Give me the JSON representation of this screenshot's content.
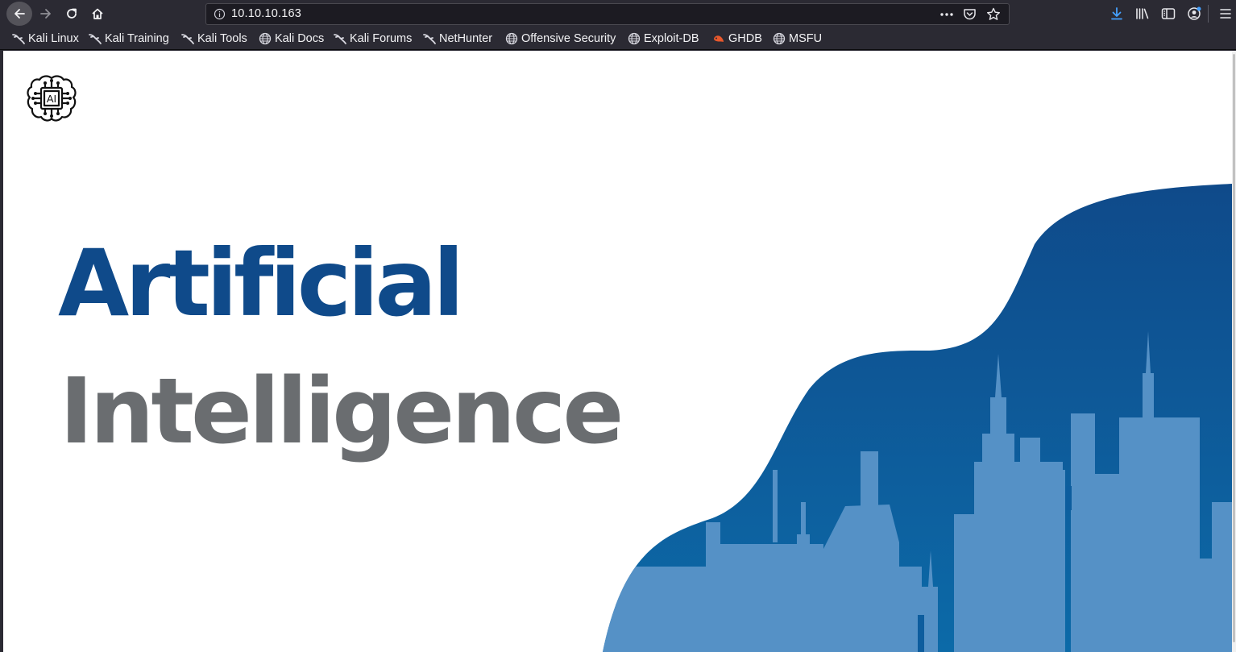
{
  "browser": {
    "url": "10.10.10.163",
    "bookmarks": [
      {
        "label": "Kali Linux",
        "icon": "kali-dragon-icon"
      },
      {
        "label": "Kali Training",
        "icon": "kali-dragon-icon"
      },
      {
        "label": "Kali Tools",
        "icon": "kali-dragon-icon"
      },
      {
        "label": "Kali Docs",
        "icon": "globe-icon"
      },
      {
        "label": "Kali Forums",
        "icon": "kali-dragon-icon"
      },
      {
        "label": "NetHunter",
        "icon": "kali-dragon-icon"
      },
      {
        "label": "Offensive Security",
        "icon": "globe-icon"
      },
      {
        "label": "Exploit-DB",
        "icon": "globe-icon"
      },
      {
        "label": "GHDB",
        "icon": "ghdb-icon"
      },
      {
        "label": "MSFU",
        "icon": "globe-icon"
      }
    ]
  },
  "page": {
    "logo_text": "AI",
    "headline_1": "Artificial",
    "headline_2": "Intelligence"
  },
  "colors": {
    "headline_blue": "#0f4a8a",
    "headline_gray": "#6a6d70",
    "wave_top": "#0f4a8a",
    "wave_bottom": "#0c6aa8",
    "skyline": "#5591c6"
  }
}
